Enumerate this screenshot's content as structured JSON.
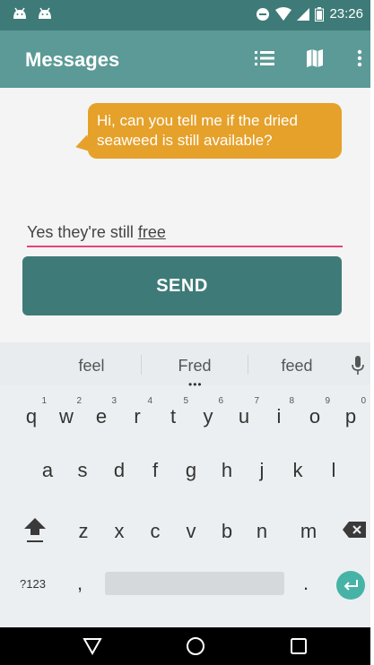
{
  "status_bar": {
    "time": "23:26"
  },
  "app_bar": {
    "title": "Messages",
    "actions": [
      "list-icon",
      "map-icon",
      "more-vert-icon"
    ]
  },
  "message": {
    "text": "Hi, can you tell me if the dried seaweed is still available?",
    "bubble_color": "#e5a12a"
  },
  "input": {
    "value_prefix": "Yes they're still ",
    "value_current_word": "free"
  },
  "send_button": {
    "label": "SEND"
  },
  "keyboard": {
    "suggestions": [
      "feel",
      "Fred",
      "feed"
    ],
    "row1": [
      {
        "key": "q",
        "num": "1"
      },
      {
        "key": "w",
        "num": "2"
      },
      {
        "key": "e",
        "num": "3"
      },
      {
        "key": "r",
        "num": "4"
      },
      {
        "key": "t",
        "num": "5"
      },
      {
        "key": "y",
        "num": "6"
      },
      {
        "key": "u",
        "num": "7"
      },
      {
        "key": "i",
        "num": "8"
      },
      {
        "key": "o",
        "num": "9"
      },
      {
        "key": "p",
        "num": "0"
      }
    ],
    "row2": [
      "a",
      "s",
      "d",
      "f",
      "g",
      "h",
      "j",
      "k",
      "l"
    ],
    "row3": [
      "z",
      "x",
      "c",
      "v",
      "b",
      "n",
      "m"
    ],
    "symbols_label": "?123",
    "comma": ",",
    "period": "."
  },
  "colors": {
    "status_bar": "#3e7b78",
    "app_bar": "#5b9a96",
    "send_button": "#3e7b78",
    "input_underline": "#e5437a",
    "enter_key": "#46b3a6"
  }
}
